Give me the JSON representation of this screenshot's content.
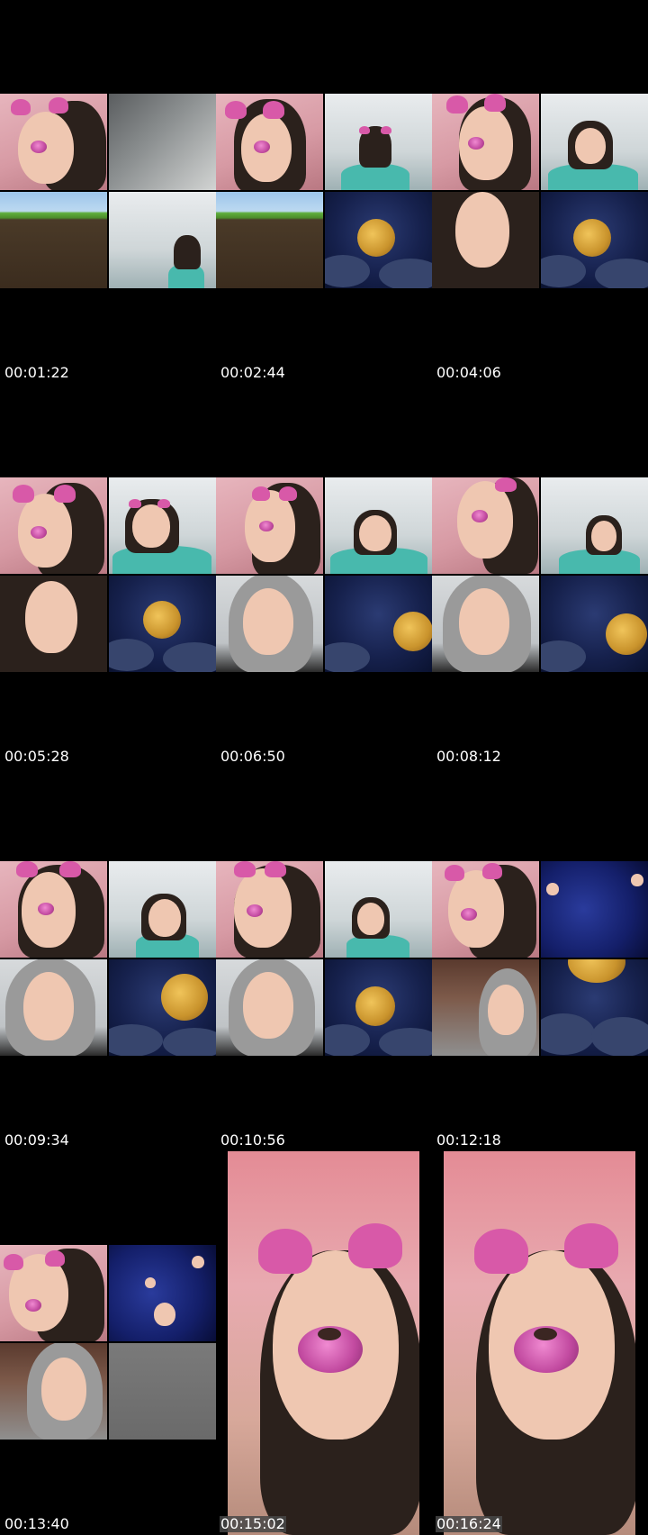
{
  "thumbnails": [
    {
      "timestamp": "00:01:22"
    },
    {
      "timestamp": "00:02:44"
    },
    {
      "timestamp": "00:04:06"
    },
    {
      "timestamp": "00:05:28"
    },
    {
      "timestamp": "00:06:50"
    },
    {
      "timestamp": "00:08:12"
    },
    {
      "timestamp": "00:09:34"
    },
    {
      "timestamp": "00:10:56"
    },
    {
      "timestamp": "00:12:18"
    },
    {
      "timestamp": "00:13:40"
    },
    {
      "timestamp": "00:15:02"
    },
    {
      "timestamp": "00:16:24"
    }
  ]
}
